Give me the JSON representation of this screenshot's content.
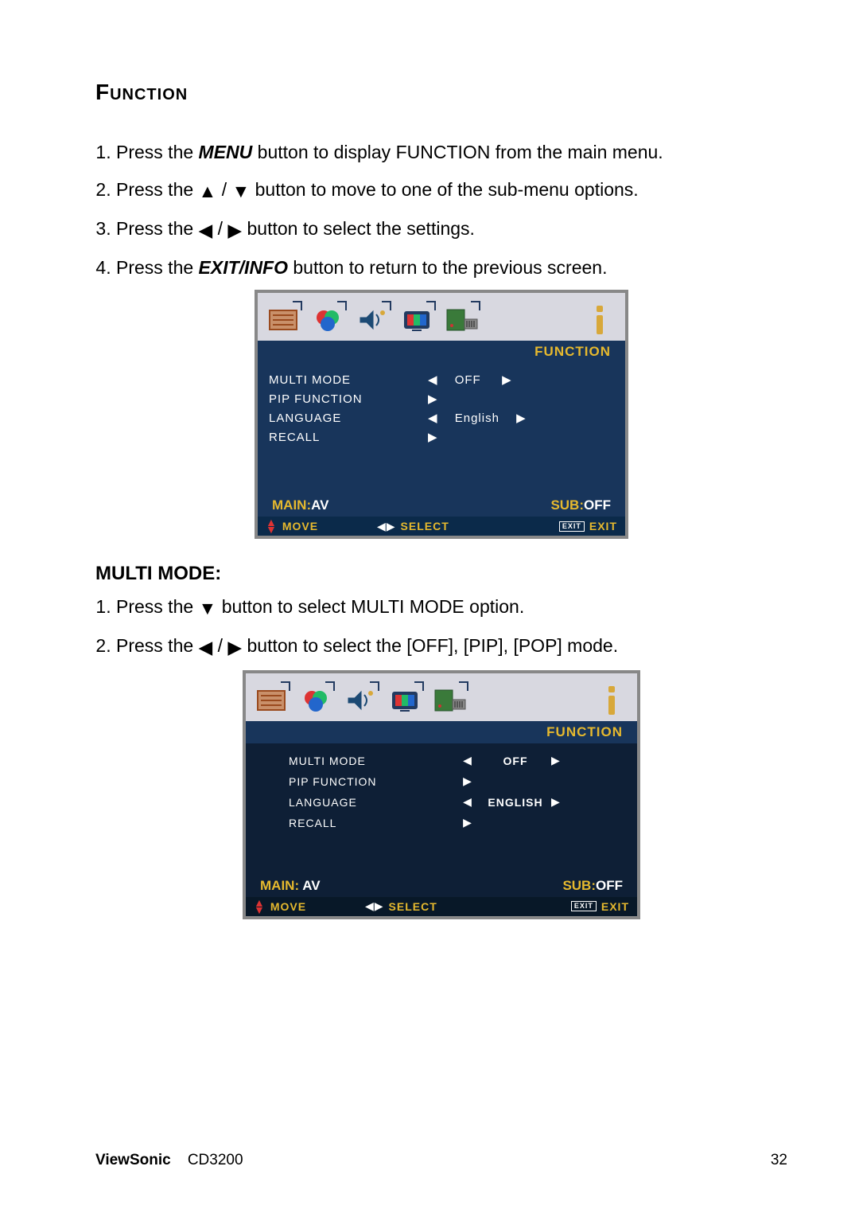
{
  "section_title": "Function",
  "steps_main": [
    {
      "pre": "Press the ",
      "bold": "MENU",
      "post": " button to display FUNCTION from the main menu."
    },
    {
      "pre": "Press the ",
      "icons": "updown",
      "post": " button to move to one of the sub-menu options."
    },
    {
      "pre": "Press the ",
      "icons": "leftright",
      "post": " button to select the settings."
    },
    {
      "pre": "Press the ",
      "bold": "EXIT/INFO",
      "post": " button to return to the previous screen."
    }
  ],
  "osd1": {
    "title": "FUNCTION",
    "rows": [
      {
        "label": "MULTI  MODE",
        "left": true,
        "value": "OFF",
        "right": true
      },
      {
        "label": "PIP  FUNCTION",
        "left": false,
        "value": "",
        "right": true
      },
      {
        "label": "LANGUAGE",
        "left": true,
        "value": "English",
        "right": true
      },
      {
        "label": "RECALL",
        "left": false,
        "value": "",
        "right": true
      }
    ],
    "status": {
      "main_label": "MAIN:",
      "main_value": "AV",
      "sub_label": "SUB:",
      "sub_value": "OFF"
    },
    "footer": {
      "move": "MOVE",
      "select": "SELECT",
      "exit": "EXIT",
      "exit_box": "EXIT"
    }
  },
  "subheading": "MULTI MODE:",
  "steps_multi": [
    {
      "pre": "Press the ",
      "icons": "down",
      "post": " button to select MULTI MODE option."
    },
    {
      "pre": "Press the ",
      "icons": "leftright",
      "post": " button to select the [OFF], [PIP], [POP] mode."
    }
  ],
  "osd2": {
    "title": "FUNCTION",
    "rows": [
      {
        "label": "MULTI  MODE",
        "left": true,
        "value": "OFF",
        "right": true
      },
      {
        "label": "PIP  FUNCTION",
        "left": false,
        "value": "",
        "right": true
      },
      {
        "label": "LANGUAGE",
        "left": true,
        "value": "ENGLISH",
        "right": true
      },
      {
        "label": "RECALL",
        "left": false,
        "value": "",
        "right": true
      }
    ],
    "status": {
      "main_label": "MAIN:",
      "main_value": "AV",
      "sub_label": "SUB:",
      "sub_value": "OFF"
    },
    "footer": {
      "move": "MOVE",
      "select": "SELECT",
      "exit": "EXIT",
      "exit_box": "EXIT"
    }
  },
  "footer": {
    "brand": "ViewSonic",
    "model": "CD3200",
    "page": "32"
  }
}
